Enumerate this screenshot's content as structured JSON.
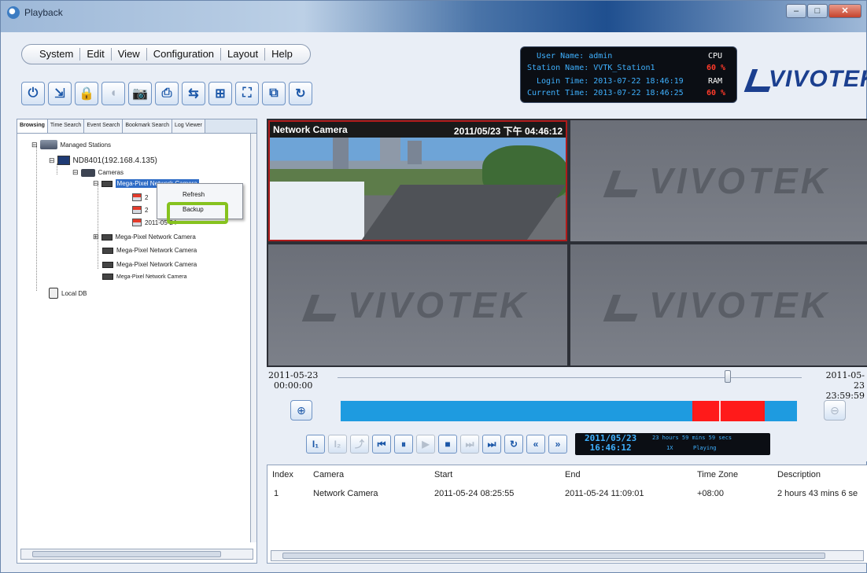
{
  "window": {
    "title": "Playback"
  },
  "menu": [
    "System",
    "Edit",
    "View",
    "Configuration",
    "Layout",
    "Help"
  ],
  "toolbar": [
    {
      "icon": "power-icon",
      "glyph": "⏻"
    },
    {
      "icon": "export-icon",
      "glyph": "⇲"
    },
    {
      "icon": "lock-icon",
      "glyph": "🔒"
    },
    {
      "icon": "audio-icon",
      "glyph": "◖",
      "disabled": true
    },
    {
      "icon": "snapshot-icon",
      "glyph": "📷"
    },
    {
      "icon": "print-icon",
      "glyph": "⎙"
    },
    {
      "icon": "backup-icon",
      "glyph": "⇆"
    },
    {
      "icon": "layout-icon",
      "glyph": "⊞"
    },
    {
      "icon": "fullscreen-icon",
      "glyph": "⛶"
    },
    {
      "icon": "sequence-icon",
      "glyph": "⧉"
    },
    {
      "icon": "refresh-icon",
      "glyph": "↻"
    }
  ],
  "info": {
    "user_name": "User Name: admin",
    "station_name": "Station Name: VVTK_Station1",
    "login_time": "Login Time: 2013-07-22 18:46:19",
    "current_time": "Current Time: 2013-07-22 18:46:25",
    "cpu_label": "CPU",
    "cpu_value": "60 %",
    "ram_label": "RAM",
    "ram_value": "60 %"
  },
  "logo": {
    "text": "VIVOTEK"
  },
  "left": {
    "tabs": [
      "Browsing",
      "Time Search",
      "Event Search",
      "Bookmark Search",
      "Log Viewer"
    ],
    "tree": {
      "root": "Managed Stations",
      "station": "ND8401(192.168.4.135)",
      "cameras": "Cameras",
      "selected_camera": "Mega-Pixel Network Camera",
      "rec1": "2",
      "rec2": "2",
      "rec3": "2011-05-24",
      "cam2": "Mega-Pixel Network Camera",
      "cam3": "Mega-Pixel Network Camera",
      "cam4": "Mega-Pixel Network Camera",
      "cam5": "Mega-Pixel Network Camera",
      "local": "Local DB"
    },
    "context_menu": [
      "Refresh",
      "Backup"
    ]
  },
  "video": {
    "cam_name": "Network Camera",
    "cam_datetime": "2011/05/23 下午 04:46:12",
    "watermark": "VIVOTEK"
  },
  "timeline": {
    "start_date": "2011-05-23",
    "start_time": "00:00:00",
    "end_date": "2011-05-23",
    "end_time": "23:59:59",
    "slider_position": 0.84,
    "segments": [
      {
        "start": 0.77,
        "end": 0.83
      },
      {
        "start": 0.83,
        "end": 0.93
      }
    ]
  },
  "controls": {
    "buttons": [
      {
        "icon": "marker-in-icon",
        "glyph": "I₁"
      },
      {
        "icon": "marker-out-icon",
        "glyph": "I₂",
        "disabled": true
      },
      {
        "icon": "export-clip-icon",
        "glyph": "⤴",
        "disabled": true
      },
      {
        "icon": "go-start-icon",
        "glyph": "⏮"
      },
      {
        "icon": "pause-icon",
        "glyph": "⏸"
      },
      {
        "icon": "play-icon",
        "glyph": "▶",
        "disabled": true
      },
      {
        "icon": "stop-icon",
        "glyph": "■"
      },
      {
        "icon": "next-frame-icon",
        "glyph": "⏭",
        "disabled": true
      },
      {
        "icon": "go-end-icon",
        "glyph": "⏭"
      },
      {
        "icon": "loop-icon",
        "glyph": "↻"
      },
      {
        "icon": "slower-icon",
        "glyph": "«"
      },
      {
        "icon": "faster-icon",
        "glyph": "»"
      }
    ],
    "lcd_date": "2011/05/23",
    "lcd_time": "16:46:12",
    "lcd_duration": "23 hours 59 mins 59 secs",
    "lcd_speed": "1X",
    "lcd_state": "Playing"
  },
  "results": {
    "columns": [
      "Index",
      "Camera",
      "Start",
      "End",
      "Time Zone",
      "Description"
    ],
    "rows": [
      [
        "1",
        "Network Camera",
        "2011-05-24 08:25:55",
        "2011-05-24 11:09:01",
        "+08:00",
        "2 hours 43 mins 6 se"
      ]
    ]
  }
}
